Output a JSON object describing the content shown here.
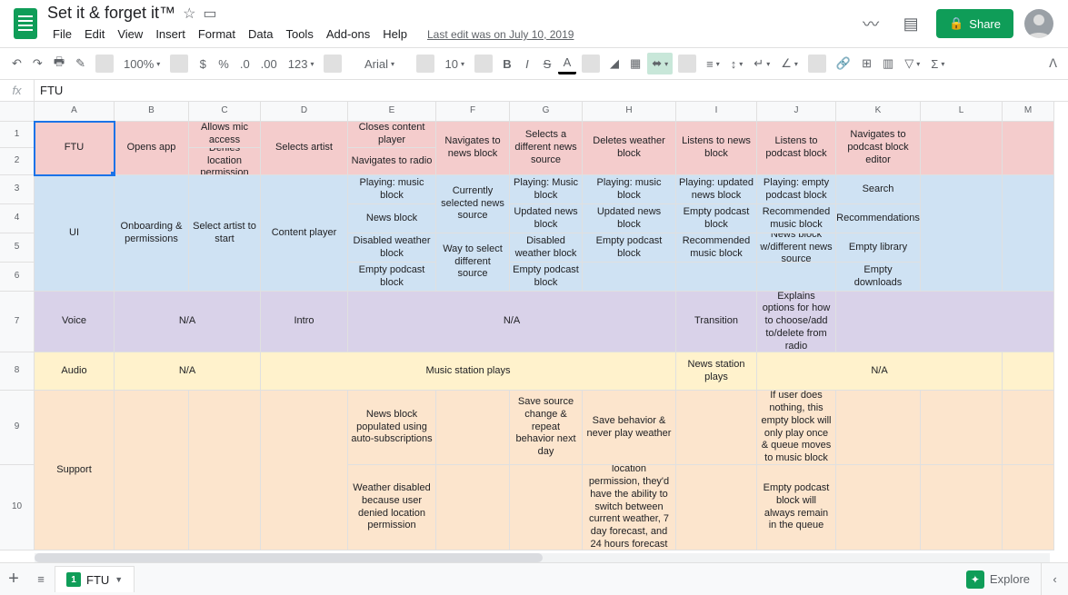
{
  "doc": {
    "title": "Set it & forget it™",
    "last_edit": "Last edit was on July 10, 2019"
  },
  "menu": {
    "file": "File",
    "edit": "Edit",
    "view": "View",
    "insert": "Insert",
    "format": "Format",
    "data": "Data",
    "tools": "Tools",
    "addons": "Add-ons",
    "help": "Help"
  },
  "share": "Share",
  "toolbar": {
    "zoom": "100%",
    "font": "Arial",
    "fontsize": "10",
    "more_formats": "123"
  },
  "fx": {
    "value": "FTU"
  },
  "cols": [
    "A",
    "B",
    "C",
    "D",
    "E",
    "F",
    "G",
    "H",
    "I",
    "J",
    "K",
    "L",
    "M"
  ],
  "rownums": [
    "1",
    "2",
    "3",
    "4",
    "5",
    "6",
    "7",
    "8",
    "9",
    "10"
  ],
  "grid_cols": "38px 88px 82px 79px 96px 97px 81px 80px 103px 89px 87px 93px 90px 57px",
  "row_heights": [
    "22px",
    "29px",
    "30px",
    "32px",
    "32px",
    "32px",
    "32px",
    "67px",
    "42px",
    "82px",
    "94px"
  ],
  "cells": [
    {
      "r": 1,
      "c": 1,
      "rs": 2,
      "cs": 1,
      "t": "FTU",
      "cls": "pink selected"
    },
    {
      "r": 1,
      "c": 2,
      "rs": 2,
      "cs": 1,
      "t": "Opens app",
      "cls": "pink"
    },
    {
      "r": 1,
      "c": 3,
      "t": "Allows mic access",
      "cls": "pink"
    },
    {
      "r": 2,
      "c": 3,
      "t": "Denies location permission",
      "cls": "pink"
    },
    {
      "r": 1,
      "c": 4,
      "rs": 2,
      "cs": 1,
      "t": "Selects artist",
      "cls": "pink"
    },
    {
      "r": 1,
      "c": 5,
      "t": "Closes content player",
      "cls": "pink"
    },
    {
      "r": 2,
      "c": 5,
      "t": "Navigates to radio",
      "cls": "pink"
    },
    {
      "r": 1,
      "c": 6,
      "rs": 2,
      "cs": 1,
      "t": "Navigates to news block",
      "cls": "pink"
    },
    {
      "r": 1,
      "c": 7,
      "rs": 2,
      "cs": 1,
      "t": "Selects a different news source",
      "cls": "pink"
    },
    {
      "r": 1,
      "c": 8,
      "rs": 2,
      "cs": 1,
      "t": "Deletes weather block",
      "cls": "pink"
    },
    {
      "r": 1,
      "c": 9,
      "rs": 2,
      "cs": 1,
      "t": "Listens to news block",
      "cls": "pink"
    },
    {
      "r": 1,
      "c": 10,
      "rs": 2,
      "cs": 1,
      "t": "Listens to podcast block",
      "cls": "pink"
    },
    {
      "r": 1,
      "c": 11,
      "rs": 2,
      "cs": 1,
      "t": "Navigates to podcast block editor",
      "cls": "pink"
    },
    {
      "r": 1,
      "c": 12,
      "rs": 2,
      "cs": 1,
      "t": "",
      "cls": "pink"
    },
    {
      "r": 1,
      "c": 13,
      "rs": 2,
      "cs": 1,
      "t": "",
      "cls": "pink"
    },
    {
      "r": 3,
      "c": 1,
      "rs": 4,
      "cs": 1,
      "t": "UI",
      "cls": "blue"
    },
    {
      "r": 3,
      "c": 2,
      "rs": 4,
      "cs": 1,
      "t": "Onboarding & permissions",
      "cls": "blue"
    },
    {
      "r": 3,
      "c": 3,
      "rs": 4,
      "cs": 1,
      "t": "Select artist to start",
      "cls": "blue"
    },
    {
      "r": 3,
      "c": 4,
      "rs": 4,
      "cs": 1,
      "t": "Content player",
      "cls": "blue"
    },
    {
      "r": 3,
      "c": 5,
      "t": "Playing: music block",
      "cls": "blue"
    },
    {
      "r": 4,
      "c": 5,
      "t": "News block",
      "cls": "blue"
    },
    {
      "r": 5,
      "c": 5,
      "t": "Disabled weather block",
      "cls": "blue"
    },
    {
      "r": 6,
      "c": 5,
      "t": "Empty podcast block",
      "cls": "blue"
    },
    {
      "r": 3,
      "c": 6,
      "rs": 2,
      "cs": 1,
      "t": "Currently selected news source",
      "cls": "blue"
    },
    {
      "r": 5,
      "c": 6,
      "rs": 2,
      "cs": 1,
      "t": "Way to select different source",
      "cls": "blue"
    },
    {
      "r": 3,
      "c": 7,
      "t": "Playing: Music block",
      "cls": "blue"
    },
    {
      "r": 4,
      "c": 7,
      "t": "Updated news block",
      "cls": "blue"
    },
    {
      "r": 5,
      "c": 7,
      "t": "Disabled weather block",
      "cls": "blue"
    },
    {
      "r": 6,
      "c": 7,
      "t": "Empty podcast block",
      "cls": "blue"
    },
    {
      "r": 3,
      "c": 8,
      "t": "Playing: music block",
      "cls": "blue"
    },
    {
      "r": 4,
      "c": 8,
      "t": "Updated news block",
      "cls": "blue"
    },
    {
      "r": 5,
      "c": 8,
      "t": "Empty podcast block",
      "cls": "blue"
    },
    {
      "r": 6,
      "c": 8,
      "t": "",
      "cls": "blue"
    },
    {
      "r": 3,
      "c": 9,
      "t": "Playing: updated news block",
      "cls": "blue"
    },
    {
      "r": 4,
      "c": 9,
      "t": "Empty podcast block",
      "cls": "blue"
    },
    {
      "r": 5,
      "c": 9,
      "t": "Recommended music block",
      "cls": "blue"
    },
    {
      "r": 6,
      "c": 9,
      "t": "",
      "cls": "blue"
    },
    {
      "r": 3,
      "c": 10,
      "t": "Playing: empty podcast block",
      "cls": "blue"
    },
    {
      "r": 4,
      "c": 10,
      "t": "Recommended music block",
      "cls": "blue"
    },
    {
      "r": 5,
      "c": 10,
      "t": "News block w/different news source",
      "cls": "blue"
    },
    {
      "r": 6,
      "c": 10,
      "t": "",
      "cls": "blue"
    },
    {
      "r": 3,
      "c": 11,
      "t": "Search",
      "cls": "blue"
    },
    {
      "r": 4,
      "c": 11,
      "t": "Recommendations",
      "cls": "blue"
    },
    {
      "r": 5,
      "c": 11,
      "t": "Empty library",
      "cls": "blue"
    },
    {
      "r": 6,
      "c": 11,
      "t": "Empty downloads",
      "cls": "blue"
    },
    {
      "r": 3,
      "c": 12,
      "rs": 4,
      "cs": 1,
      "t": "",
      "cls": "blue"
    },
    {
      "r": 3,
      "c": 13,
      "rs": 4,
      "cs": 1,
      "t": "",
      "cls": "blue"
    },
    {
      "r": 7,
      "c": 1,
      "t": "Voice",
      "cls": "purple"
    },
    {
      "r": 7,
      "c": 2,
      "cs": 2,
      "t": "N/A",
      "cls": "purple"
    },
    {
      "r": 7,
      "c": 4,
      "t": "Intro",
      "cls": "purple"
    },
    {
      "r": 7,
      "c": 5,
      "cs": 4,
      "t": "N/A",
      "cls": "purple"
    },
    {
      "r": 7,
      "c": 9,
      "t": "Transition",
      "cls": "purple"
    },
    {
      "r": 7,
      "c": 10,
      "t": "Explains options for how to choose/add to/delete from radio",
      "cls": "purple"
    },
    {
      "r": 7,
      "c": 11,
      "cs": 3,
      "t": "",
      "cls": "purple"
    },
    {
      "r": 8,
      "c": 1,
      "t": "Audio",
      "cls": "yellow"
    },
    {
      "r": 8,
      "c": 2,
      "cs": 2,
      "t": "N/A",
      "cls": "yellow"
    },
    {
      "r": 8,
      "c": 4,
      "cs": 5,
      "t": "Music station plays",
      "cls": "yellow"
    },
    {
      "r": 8,
      "c": 9,
      "t": "News station plays",
      "cls": "yellow"
    },
    {
      "r": 8,
      "c": 10,
      "cs": 3,
      "t": "N/A",
      "cls": "yellow"
    },
    {
      "r": 8,
      "c": 13,
      "t": "",
      "cls": "yellow"
    },
    {
      "r": 9,
      "c": 1,
      "rs": 2,
      "cs": 1,
      "t": "Support",
      "cls": "orange"
    },
    {
      "r": 9,
      "c": 2,
      "rs": 2,
      "cs": 1,
      "t": "",
      "cls": "orange"
    },
    {
      "r": 9,
      "c": 3,
      "rs": 2,
      "cs": 1,
      "t": "",
      "cls": "orange"
    },
    {
      "r": 9,
      "c": 4,
      "rs": 2,
      "cs": 1,
      "t": "",
      "cls": "orange"
    },
    {
      "r": 9,
      "c": 5,
      "t": "News block populated using auto-subscriptions",
      "cls": "orange"
    },
    {
      "r": 10,
      "c": 5,
      "t": "Weather disabled because user denied location permission",
      "cls": "orange"
    },
    {
      "r": 9,
      "c": 6,
      "t": "",
      "cls": "orange"
    },
    {
      "r": 10,
      "c": 6,
      "t": "",
      "cls": "orange"
    },
    {
      "r": 9,
      "c": 7,
      "t": "Save source change & repeat behavior next day",
      "cls": "orange"
    },
    {
      "r": 10,
      "c": 7,
      "t": "",
      "cls": "orange"
    },
    {
      "r": 9,
      "c": 8,
      "t": "Save behavior & never play weather",
      "cls": "orange"
    },
    {
      "r": 10,
      "c": 8,
      "t": "If user had allowed location permission, they'd have the ability to switch between current weather, 7 day forecast, and 24 hours forecast here",
      "cls": "orange"
    },
    {
      "r": 9,
      "c": 9,
      "t": "",
      "cls": "orange"
    },
    {
      "r": 10,
      "c": 9,
      "t": "",
      "cls": "orange"
    },
    {
      "r": 9,
      "c": 10,
      "t": "If user does nothing, this empty block will only play once & queue moves to music block",
      "cls": "orange"
    },
    {
      "r": 10,
      "c": 10,
      "t": "Empty podcast block will always remain in the queue",
      "cls": "orange"
    },
    {
      "r": 9,
      "c": 11,
      "t": "",
      "cls": "orange"
    },
    {
      "r": 10,
      "c": 11,
      "t": "",
      "cls": "orange"
    },
    {
      "r": 9,
      "c": 12,
      "t": "",
      "cls": "orange"
    },
    {
      "r": 10,
      "c": 12,
      "t": "",
      "cls": "orange"
    },
    {
      "r": 9,
      "c": 13,
      "t": "",
      "cls": "orange"
    },
    {
      "r": 10,
      "c": 13,
      "t": "",
      "cls": "orange"
    }
  ],
  "sheet": {
    "number": "1",
    "name": "FTU"
  },
  "explore": "Explore"
}
